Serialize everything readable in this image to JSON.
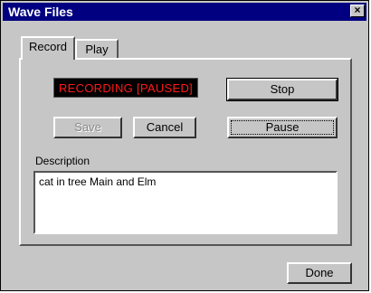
{
  "window": {
    "title": "Wave Files",
    "close_glyph": "×"
  },
  "tabs": [
    {
      "label": "Record",
      "active": true
    },
    {
      "label": "Play",
      "active": false
    }
  ],
  "record": {
    "status_text": "RECORDING [PAUSED]",
    "stop_label": "Stop",
    "save_label": "Save",
    "cancel_label": "Cancel",
    "pause_label": "Pause",
    "description_label": "Description",
    "description_value": "cat in tree Main and Elm"
  },
  "footer": {
    "done_label": "Done"
  },
  "colors": {
    "titlebar": "#000080",
    "status_text": "#ff1a1a",
    "face": "#c6c6c6"
  }
}
